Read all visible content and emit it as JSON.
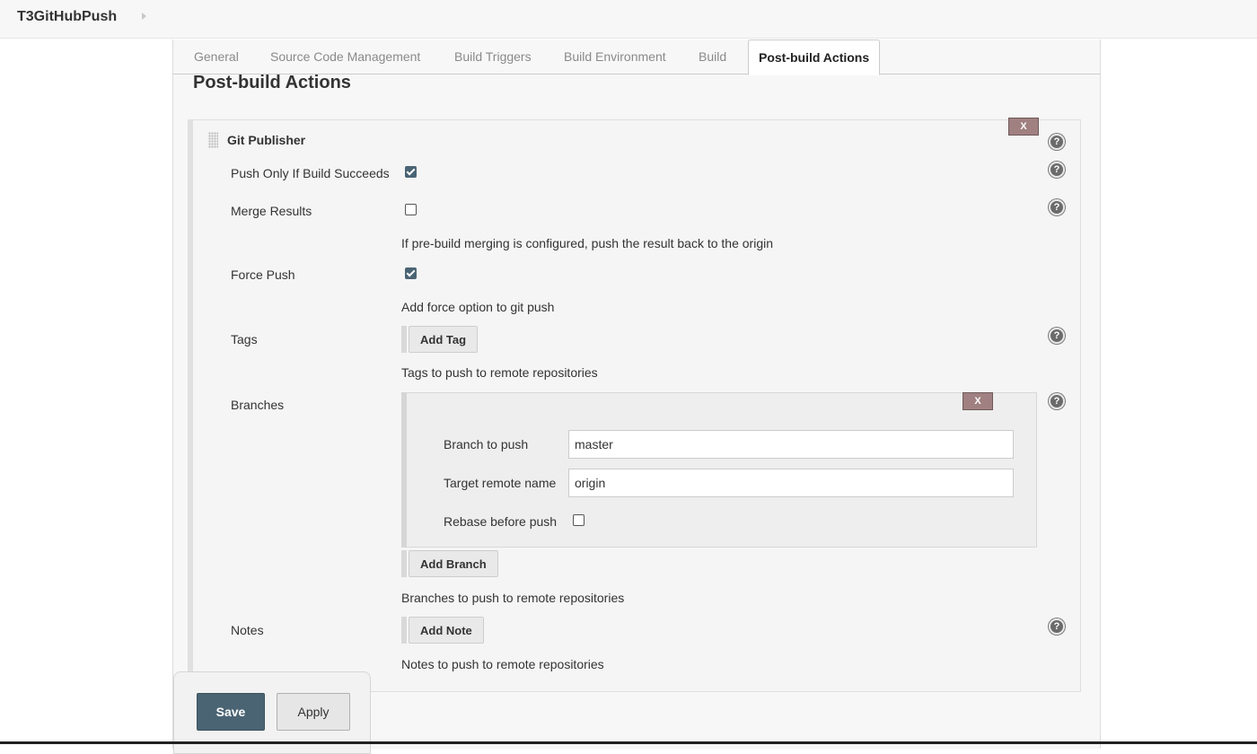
{
  "breadcrumb": {
    "job_name": "T3GitHubPush"
  },
  "tabs": [
    {
      "label": "General"
    },
    {
      "label": "Source Code Management"
    },
    {
      "label": "Build Triggers"
    },
    {
      "label": "Build Environment"
    },
    {
      "label": "Build"
    },
    {
      "label": "Post-build Actions",
      "active": true
    }
  ],
  "section": {
    "title": "Post-build Actions"
  },
  "git_publisher": {
    "title": "Git Publisher",
    "delete_label": "X",
    "help_label": "?",
    "push_only_if_success": {
      "label": "Push Only If Build Succeeds",
      "checked": true
    },
    "merge_results": {
      "label": "Merge Results",
      "checked": false,
      "description": "If pre-build merging is configured, push the result back to the origin"
    },
    "force_push": {
      "label": "Force Push",
      "checked": true,
      "description": "Add force option to git push"
    },
    "tags": {
      "label": "Tags",
      "add_button": "Add Tag",
      "description": "Tags to push to remote repositories"
    },
    "branches": {
      "label": "Branches",
      "delete_label": "X",
      "branch_to_push": {
        "label": "Branch to push",
        "value": "master"
      },
      "target_remote": {
        "label": "Target remote name",
        "value": "origin"
      },
      "rebase": {
        "label": "Rebase before push",
        "checked": false
      },
      "add_button": "Add Branch",
      "description": "Branches to push to remote repositories"
    },
    "notes": {
      "label": "Notes",
      "add_button": "Add Note",
      "description": "Notes to push to remote repositories"
    }
  },
  "footer": {
    "save_label": "Save",
    "apply_label": "Apply"
  },
  "colors": {
    "save_button": "#4a6474",
    "delete_button": "#a08080",
    "checkbox_checked": "#4a6474",
    "panel_bg": "#f7f7f7"
  },
  "icons": [
    "help-icon",
    "drag-handle-icon",
    "chevron-right-icon"
  ]
}
